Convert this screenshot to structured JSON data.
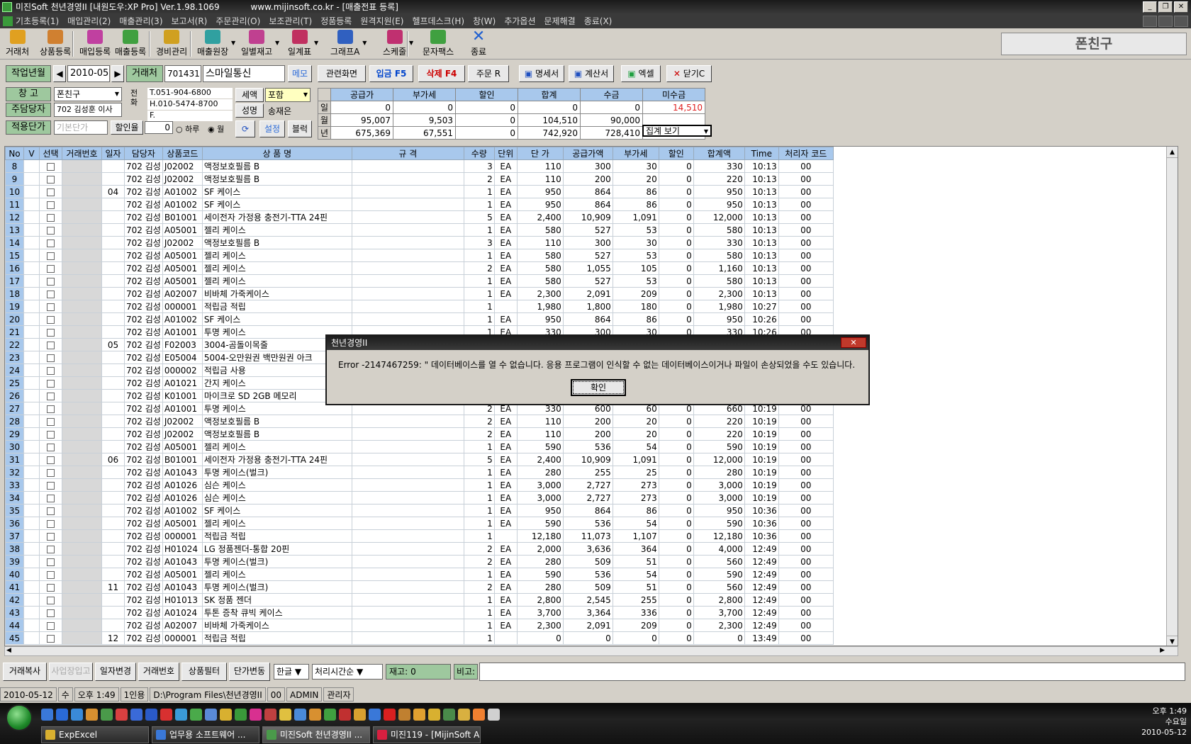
{
  "window": {
    "title": "미진Soft 천년경영II [내원도우:XP Pro] Ver.1.98.1069",
    "url": "www.mijinsoft.co.kr - [매출전표 등록]"
  },
  "menu": [
    "기초등록(1)",
    "매입관리(2)",
    "매출관리(3)",
    "보고서(R)",
    "주문관리(O)",
    "보조관리(T)",
    "정품등록",
    "원격지원(E)",
    "헬프데스크(H)",
    "창(W)",
    "추가옵션",
    "문제해결",
    "종료(X)"
  ],
  "toolbar": [
    {
      "label": "거래처",
      "icon": "people-icon",
      "color": "#e0a020"
    },
    {
      "label": "상품등록",
      "icon": "box-icon",
      "color": "#d08030"
    },
    {
      "label": "매입등록",
      "icon": "purchase-icon",
      "color": "#c040a0"
    },
    {
      "label": "매출등록",
      "icon": "sales-icon",
      "color": "#40a040"
    },
    {
      "label": "경비관리",
      "icon": "coins-icon",
      "color": "#d0a020"
    },
    {
      "label": "매출원장",
      "icon": "ledger-icon",
      "color": "#30a0a0"
    },
    {
      "label": "일별재고",
      "icon": "stock-icon",
      "color": "#c04090"
    },
    {
      "label": "일계표",
      "icon": "daily-icon",
      "color": "#c03060"
    },
    {
      "label": "그래프A",
      "icon": "chart-icon",
      "color": "#3060c0"
    },
    {
      "label": "스케줄",
      "icon": "schedule-icon",
      "color": "#c03070"
    },
    {
      "label": "문자팩스",
      "icon": "phone-icon",
      "color": "#40a040"
    },
    {
      "label": "종료",
      "icon": "exit-icon",
      "color": "#2060d0"
    }
  ],
  "partner_display": "폰친구",
  "header": {
    "work_month_label": "작업년월",
    "work_month": "2010-05",
    "client_label": "거래처",
    "client_code": "701431",
    "client_name": "스마일통신",
    "memo": "메모",
    "warehouse_label": "창 고",
    "warehouse": "폰친구",
    "manager_label": "주담당자",
    "manager": "702 김성훈 이사",
    "price_label": "적용단가",
    "price_placeholder": "기본단가",
    "discount_label": "할인율",
    "discount_value": "0",
    "period_day": "하루",
    "period_month": "월",
    "phone_label": "전화",
    "tel": "T.051-904-6800",
    "hp": "H.010-5474-8700",
    "fax": "F.",
    "tax_label": "세액",
    "tax_value": "포함",
    "name_label": "성명",
    "name_value": "송재은",
    "settings": "설정",
    "block": "블럭"
  },
  "actions": [
    "관련화면",
    "입금 F5",
    "삭제 F4",
    "주문 R",
    "명세서",
    "계산서",
    "엑셀",
    "닫기C"
  ],
  "summary": {
    "headers": [
      "공급가",
      "부가세",
      "할인",
      "합계",
      "수금",
      "미수금"
    ],
    "rows": [
      {
        "label": "일",
        "values": [
          "0",
          "0",
          "0",
          "0",
          "0",
          "14,510"
        ]
      },
      {
        "label": "월",
        "values": [
          "95,007",
          "9,503",
          "0",
          "104,510",
          "90,000",
          ""
        ]
      },
      {
        "label": "년",
        "values": [
          "675,369",
          "67,551",
          "0",
          "742,920",
          "728,410",
          ""
        ]
      }
    ],
    "view_select": "집계 보기"
  },
  "grid": {
    "headers": [
      "No",
      "V",
      "선택",
      "거래번호",
      "일자",
      "담당자",
      "상품코드",
      "상 품 명",
      "규 격",
      "수량",
      "단위",
      "단 가",
      "공급가액",
      "부가세",
      "할인",
      "합계액",
      "Time",
      "처리자 코드"
    ],
    "rows": [
      [
        "8",
        "",
        "",
        "",
        "",
        "702 김성",
        "J02002",
        "액정보호필름 B",
        "",
        "3",
        "EA",
        "110",
        "300",
        "30",
        "0",
        "330",
        "10:13",
        "00"
      ],
      [
        "9",
        "",
        "",
        "",
        "",
        "702 김성",
        "J02002",
        "액정보호필름 B",
        "",
        "2",
        "EA",
        "110",
        "200",
        "20",
        "0",
        "220",
        "10:13",
        "00"
      ],
      [
        "10",
        "",
        "",
        "",
        "04",
        "702 김성",
        "A01002",
        "SF 케이스",
        "",
        "1",
        "EA",
        "950",
        "864",
        "86",
        "0",
        "950",
        "10:13",
        "00"
      ],
      [
        "11",
        "",
        "",
        "",
        "",
        "702 김성",
        "A01002",
        "SF 케이스",
        "",
        "1",
        "EA",
        "950",
        "864",
        "86",
        "0",
        "950",
        "10:13",
        "00"
      ],
      [
        "12",
        "",
        "",
        "",
        "",
        "702 김성",
        "B01001",
        "세이전자 가정용 충전기-TTA 24핀",
        "",
        "5",
        "EA",
        "2,400",
        "10,909",
        "1,091",
        "0",
        "12,000",
        "10:13",
        "00"
      ],
      [
        "13",
        "",
        "",
        "",
        "",
        "702 김성",
        "A05001",
        "젤리 케이스",
        "",
        "1",
        "EA",
        "580",
        "527",
        "53",
        "0",
        "580",
        "10:13",
        "00"
      ],
      [
        "14",
        "",
        "",
        "",
        "",
        "702 김성",
        "J02002",
        "액정보호필름 B",
        "",
        "3",
        "EA",
        "110",
        "300",
        "30",
        "0",
        "330",
        "10:13",
        "00"
      ],
      [
        "15",
        "",
        "",
        "",
        "",
        "702 김성",
        "A05001",
        "젤리 케이스",
        "",
        "1",
        "EA",
        "580",
        "527",
        "53",
        "0",
        "580",
        "10:13",
        "00"
      ],
      [
        "16",
        "",
        "",
        "",
        "",
        "702 김성",
        "A05001",
        "젤리 케이스",
        "",
        "2",
        "EA",
        "580",
        "1,055",
        "105",
        "0",
        "1,160",
        "10:13",
        "00"
      ],
      [
        "17",
        "",
        "",
        "",
        "",
        "702 김성",
        "A05001",
        "젤리 케이스",
        "",
        "1",
        "EA",
        "580",
        "527",
        "53",
        "0",
        "580",
        "10:13",
        "00"
      ],
      [
        "18",
        "",
        "",
        "",
        "",
        "702 김성",
        "A02007",
        "비바체 가죽케이스",
        "",
        "1",
        "EA",
        "2,300",
        "2,091",
        "209",
        "0",
        "2,300",
        "10:13",
        "00"
      ],
      [
        "19",
        "",
        "",
        "",
        "",
        "702 김성",
        "000001",
        "적립금 적립",
        "",
        "1",
        "",
        "1,980",
        "1,800",
        "180",
        "0",
        "1,980",
        "10:27",
        "00"
      ],
      [
        "20",
        "",
        "",
        "",
        "",
        "702 김성",
        "A01002",
        "SF 케이스",
        "",
        "1",
        "EA",
        "950",
        "864",
        "86",
        "0",
        "950",
        "10:26",
        "00"
      ],
      [
        "21",
        "",
        "",
        "",
        "",
        "702 김성",
        "A01001",
        "투명 케이스",
        "",
        "1",
        "EA",
        "330",
        "300",
        "30",
        "0",
        "330",
        "10:26",
        "00"
      ],
      [
        "22",
        "",
        "",
        "",
        "05",
        "702 김성",
        "F02003",
        "3004-곰돌이목줄",
        "",
        "",
        "",
        "",
        "",
        "",
        "",
        "",
        "",
        "00"
      ],
      [
        "23",
        "",
        "",
        "",
        "",
        "702 김성",
        "E05004",
        "5004-오만원권 백만원권 아크",
        "",
        "",
        "",
        "",
        "",
        "",
        "",
        "",
        "",
        "00"
      ],
      [
        "24",
        "",
        "",
        "",
        "",
        "702 김성",
        "000002",
        "적립금 사용",
        "",
        "",
        "",
        "",
        "",
        "",
        "",
        "",
        "",
        "00"
      ],
      [
        "25",
        "",
        "",
        "",
        "",
        "702 김성",
        "A01021",
        "간지 케이스",
        "",
        "",
        "",
        "",
        "",
        "",
        "",
        "",
        "",
        "00"
      ],
      [
        "26",
        "",
        "",
        "",
        "",
        "702 김성",
        "K01001",
        "마이크로 SD 2GB 메모리",
        "",
        "",
        "",
        "",
        "",
        "",
        "",
        "",
        "",
        "00"
      ],
      [
        "27",
        "",
        "",
        "",
        "",
        "702 김성",
        "A01001",
        "투명 케이스",
        "",
        "2",
        "EA",
        "330",
        "600",
        "60",
        "0",
        "660",
        "10:19",
        "00"
      ],
      [
        "28",
        "",
        "",
        "",
        "",
        "702 김성",
        "J02002",
        "액정보호필름 B",
        "",
        "2",
        "EA",
        "110",
        "200",
        "20",
        "0",
        "220",
        "10:19",
        "00"
      ],
      [
        "29",
        "",
        "",
        "",
        "",
        "702 김성",
        "J02002",
        "액정보호필름 B",
        "",
        "2",
        "EA",
        "110",
        "200",
        "20",
        "0",
        "220",
        "10:19",
        "00"
      ],
      [
        "30",
        "",
        "",
        "",
        "",
        "702 김성",
        "A05001",
        "젤리 케이스",
        "",
        "1",
        "EA",
        "590",
        "536",
        "54",
        "0",
        "590",
        "10:19",
        "00"
      ],
      [
        "31",
        "",
        "",
        "",
        "06",
        "702 김성",
        "B01001",
        "세이전자 가정용 충전기-TTA 24핀",
        "",
        "5",
        "EA",
        "2,400",
        "10,909",
        "1,091",
        "0",
        "12,000",
        "10:19",
        "00"
      ],
      [
        "32",
        "",
        "",
        "",
        "",
        "702 김성",
        "A01043",
        "투명 케이스(벌크)",
        "",
        "1",
        "EA",
        "280",
        "255",
        "25",
        "0",
        "280",
        "10:19",
        "00"
      ],
      [
        "33",
        "",
        "",
        "",
        "",
        "702 김성",
        "A01026",
        "심슨 케이스",
        "",
        "1",
        "EA",
        "3,000",
        "2,727",
        "273",
        "0",
        "3,000",
        "10:19",
        "00"
      ],
      [
        "34",
        "",
        "",
        "",
        "",
        "702 김성",
        "A01026",
        "심슨 케이스",
        "",
        "1",
        "EA",
        "3,000",
        "2,727",
        "273",
        "0",
        "3,000",
        "10:19",
        "00"
      ],
      [
        "35",
        "",
        "",
        "",
        "",
        "702 김성",
        "A01002",
        "SF 케이스",
        "",
        "1",
        "EA",
        "950",
        "864",
        "86",
        "0",
        "950",
        "10:36",
        "00"
      ],
      [
        "36",
        "",
        "",
        "",
        "",
        "702 김성",
        "A05001",
        "젤리 케이스",
        "",
        "1",
        "EA",
        "590",
        "536",
        "54",
        "0",
        "590",
        "10:36",
        "00"
      ],
      [
        "37",
        "",
        "",
        "",
        "",
        "702 김성",
        "000001",
        "적립금 적립",
        "",
        "1",
        "",
        "12,180",
        "11,073",
        "1,107",
        "0",
        "12,180",
        "10:36",
        "00"
      ],
      [
        "38",
        "",
        "",
        "",
        "",
        "702 김성",
        "H01024",
        "LG 정품젠더-통합 20핀",
        "",
        "2",
        "EA",
        "2,000",
        "3,636",
        "364",
        "0",
        "4,000",
        "12:49",
        "00"
      ],
      [
        "39",
        "",
        "",
        "",
        "",
        "702 김성",
        "A01043",
        "투명 케이스(벌크)",
        "",
        "2",
        "EA",
        "280",
        "509",
        "51",
        "0",
        "560",
        "12:49",
        "00"
      ],
      [
        "40",
        "",
        "",
        "",
        "",
        "702 김성",
        "A05001",
        "젤리 케이스",
        "",
        "1",
        "EA",
        "590",
        "536",
        "54",
        "0",
        "590",
        "12:49",
        "00"
      ],
      [
        "41",
        "",
        "",
        "",
        "11",
        "702 김성",
        "A01043",
        "투명 케이스(벌크)",
        "",
        "2",
        "EA",
        "280",
        "509",
        "51",
        "0",
        "560",
        "12:49",
        "00"
      ],
      [
        "42",
        "",
        "",
        "",
        "",
        "702 김성",
        "H01013",
        "SK 정품 젠더",
        "",
        "1",
        "EA",
        "2,800",
        "2,545",
        "255",
        "0",
        "2,800",
        "12:49",
        "00"
      ],
      [
        "43",
        "",
        "",
        "",
        "",
        "702 김성",
        "A01024",
        "투톤 증착 큐빅 케이스",
        "",
        "1",
        "EA",
        "3,700",
        "3,364",
        "336",
        "0",
        "3,700",
        "12:49",
        "00"
      ],
      [
        "44",
        "",
        "",
        "",
        "",
        "702 김성",
        "A02007",
        "비바체 가죽케이스",
        "",
        "1",
        "EA",
        "2,300",
        "2,091",
        "209",
        "0",
        "2,300",
        "12:49",
        "00"
      ],
      [
        "45",
        "",
        "",
        "",
        "12",
        "702 김성",
        "000001",
        "적립금 적립",
        "",
        "1",
        "",
        "0",
        "0",
        "0",
        "0",
        "0",
        "13:49",
        "00"
      ]
    ]
  },
  "bottom": {
    "buttons": [
      "거래복사",
      "사업장입고",
      "일자변경",
      "거래번호",
      "상품필터",
      "단가변동"
    ],
    "lang": "한글",
    "sort": "처리시간순",
    "stock_label": "재고:",
    "stock_value": "0",
    "note_label": "비고:"
  },
  "status": [
    "2010-05-12",
    "수",
    "오후 1:49",
    "1인용",
    "D:\\Program Files\\천년경영II",
    "00",
    "ADMIN",
    "관리자"
  ],
  "dialog": {
    "title": "천년경영II",
    "message": "Error -2147467259: \" 데이터베이스를 열 수 없습니다. 응용 프로그램이 인식할 수 없는 데이터베이스이거나 파일이 손상되었을 수도 있습니다.",
    "ok": "확인"
  },
  "taskbar": {
    "tasks": [
      "ExpExcel",
      "업무용 소프트웨어 ...",
      "미진Soft 천년경영II ...",
      "미진119 - [MijinSoft A..."
    ],
    "time": "오후 1:49",
    "weekday": "수요일",
    "date": "2010-05-12"
  }
}
